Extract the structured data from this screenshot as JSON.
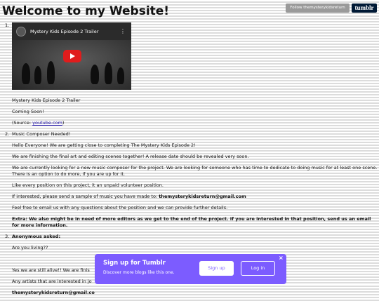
{
  "page_title": "Welcome to my Website!",
  "follow_button": "Follow themysterykidsreturn",
  "tumblr_logo": "tumblr",
  "video": {
    "title": "Mystery Kids Episode 2 Trailer",
    "menu_glyph": "⋮"
  },
  "posts": [
    {
      "number": "1.",
      "lines": [
        "Mystery Kids Episode 2 Trailer",
        "Coming Soon!"
      ],
      "source_prefix": "(Source: ",
      "source_link": "youtube.com",
      "source_suffix": ")"
    },
    {
      "number": "2.",
      "heading": "Music Composer Needed!",
      "paragraphs": [
        "Hello Everyone! We are getting close to completing The Mystery Kids Episode 2!",
        "We are finishing the final art and editing scenes together! A release date should be revealed very soon.",
        "We are currently looking for a new music composer for the project. We are looking for someone who has time to dedicate to doing music for at least one scene. There is an option to do more, if you are up for it.",
        "Like every position on this project, it an unpaid volunteer position."
      ],
      "email_prefix": "If interested, please send a sample of music you have made to: ",
      "email": "themysterykidsreturn@gmail.com",
      "paragraph_after": "Feel free to email us with any questions about the position and we can provide further details.",
      "extra": "Extra: We also might be in need of more editors as we get to the end of the project. If you are interested in that position, send us an email for more information."
    },
    {
      "number": "3.",
      "heading": "Anonymous asked:",
      "question": "Are you living??",
      "answer_1": "Yes we are still alive!! We are finis",
      "answer_2": "Any artists that are interested in jo",
      "answer_email": "themysterykidsreturn@gmail.co"
    }
  ],
  "popup": {
    "title": "Sign up for Tumblr",
    "subtitle": "Discover more blogs like this one.",
    "signup_label": "Sign up",
    "login_label": "Log in",
    "close_glyph": "×"
  },
  "colors": {
    "popup_bg": "#7c5cff",
    "tumblr_navy": "#001935",
    "link": "#1a0dab"
  }
}
